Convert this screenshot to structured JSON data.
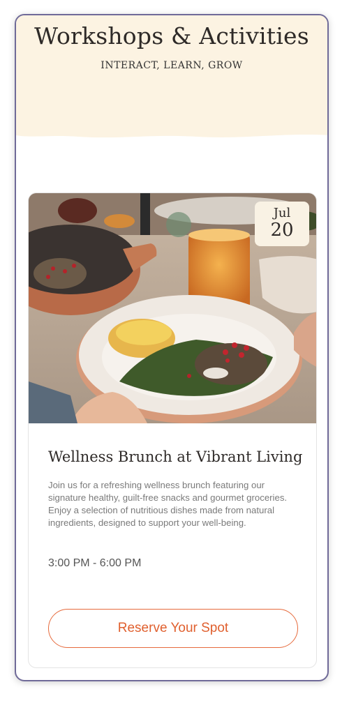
{
  "header": {
    "title": "Workshops & Activities",
    "subtitle": "INTERACT, LEARN, GROW",
    "background_color": "#fcf3e2"
  },
  "event": {
    "image_description_icon": "food-photo",
    "date": {
      "month": "Jul",
      "day": "20"
    },
    "title": "Wellness Brunch at Vibrant Living",
    "description": "Join us for a refreshing wellness brunch featuring our signature healthy, guilt-free snacks and gourmet groceries. Enjoy a selection of nutritious dishes made from natural ingredients, designed to support your well-being.",
    "time": "3:00 PM - 6:00 PM",
    "reserve_label": "Reserve Your Spot"
  },
  "colors": {
    "accent": "#e66a3c",
    "frame": "#6f6a98",
    "badge": "#f9f2e4"
  }
}
